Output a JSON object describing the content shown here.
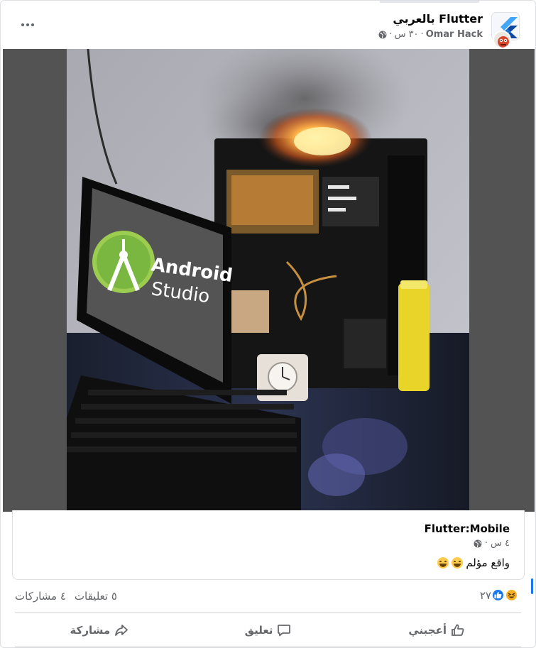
{
  "post": {
    "group_name": "Flutter بالعربي",
    "author": "Omar Hack",
    "time": "٣٠ س",
    "privacy_icon": "globe-icon",
    "more_icon": "more-options-icon"
  },
  "photo": {
    "screen_text_line1": "Android",
    "screen_text_line2": "Studio"
  },
  "shared": {
    "author": "Flutter:Mobile",
    "time": "٤ س",
    "text": "واقع مؤلم",
    "emoji_icon": "grinning-sweat-emoji-icon"
  },
  "stats": {
    "reaction_count": "٢٧",
    "reaction_icons": [
      "like-reaction-icon",
      "haha-reaction-icon"
    ],
    "comments": "٥ تعليقات",
    "shares": "٤ مشاركات"
  },
  "actions": {
    "like_label": "أعجبني",
    "comment_label": "تعليق",
    "share_label": "مشاركة"
  },
  "colors": {
    "accent": "#1877f2",
    "muted_text": "#65676b",
    "photo_background": "#535353",
    "divider": "#ced0d4"
  }
}
